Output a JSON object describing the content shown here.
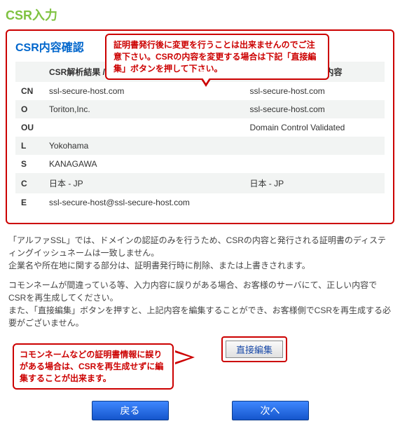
{
  "page": {
    "title": "CSR入力"
  },
  "section": {
    "title": "CSR内容確認"
  },
  "callout1": {
    "text": "証明書発行後に変更を行うことは出来ませんのでご注意下さい。CSRの内容を変更する場合は下記「直接編集」ボタンを押して下さい。"
  },
  "table": {
    "head": {
      "col1": "CSR解析結果 / スキップ入力内容",
      "col2": "発行される証明書の内容"
    },
    "rows": [
      {
        "label": "CN",
        "v1": "ssl-secure-host.com",
        "v2": "ssl-secure-host.com"
      },
      {
        "label": "O",
        "v1": "Toriton,Inc.",
        "v2": "ssl-secure-host.com"
      },
      {
        "label": "OU",
        "v1": "",
        "v2": "Domain Control Validated"
      },
      {
        "label": "L",
        "v1": "Yokohama",
        "v2": ""
      },
      {
        "label": "S",
        "v1": "KANAGAWA",
        "v2": ""
      },
      {
        "label": "C",
        "v1": "日本 - JP",
        "v2": "日本 - JP"
      },
      {
        "label": "E",
        "v1": "ssl-secure-host@ssl-secure-host.com",
        "v2": ""
      }
    ]
  },
  "notice1": "「アルファSSL」では、ドメインの認証のみを行うため、CSRの内容と発行される証明書のディスティングイッシュネームは一致しません。\n企業名や所在地に関する部分は、証明書発行時に削除、または上書きされます。",
  "notice2": "コモンネームが間違っている等、入力内容に誤りがある場合、お客様のサーバにて、正しい内容でCSRを再生成してください。\nまた、「直接編集」ボタンを押すと、上記内容を編集することができ、お客様側でCSRを再生成する必要がございません。",
  "editButton": {
    "label": "直接編集"
  },
  "callout2": {
    "text": "コモンネームなどの証明書情報に誤りがある場合は、CSRを再生成せずに編集することが出来ます。"
  },
  "nav": {
    "back": "戻る",
    "next": "次へ"
  }
}
